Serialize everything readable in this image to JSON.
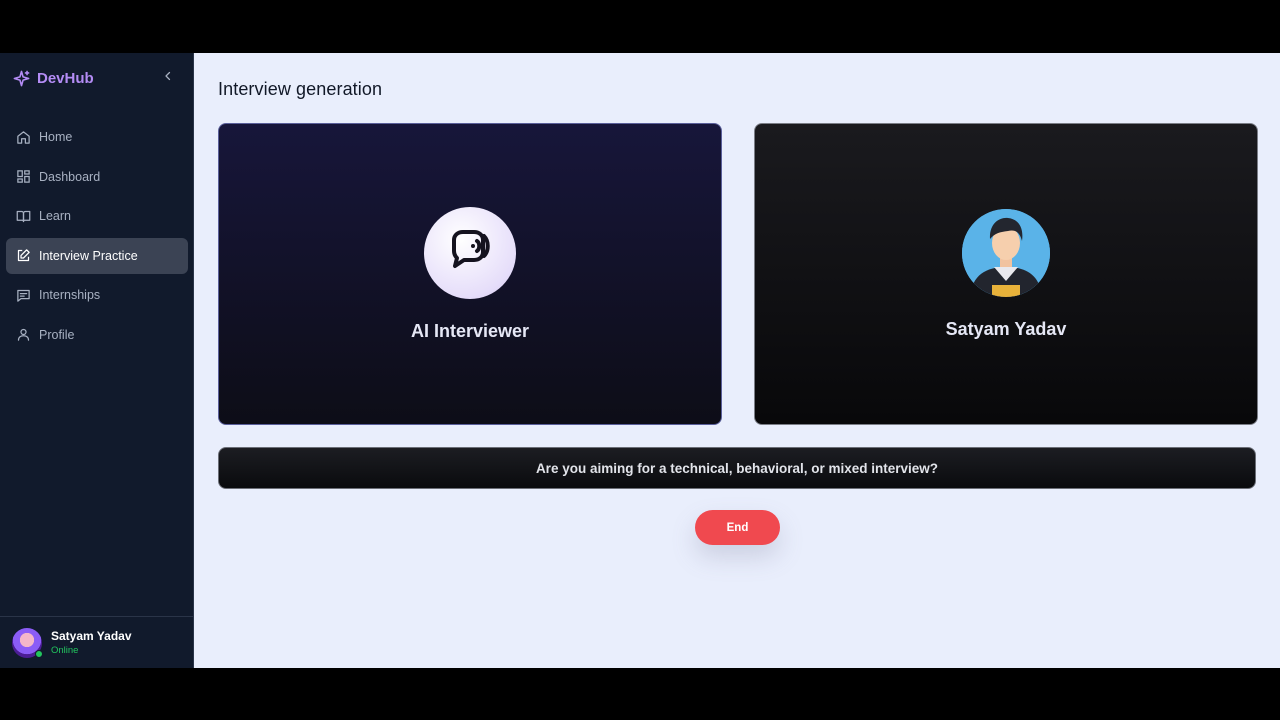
{
  "sidebar": {
    "brand": {
      "name": "DevHub",
      "icon": "sparkle-icon",
      "color": "#b48cf5"
    },
    "collapse_icon": "chevron-left-icon",
    "items": [
      {
        "label": "Home",
        "icon": "home-icon",
        "active": false
      },
      {
        "label": "Dashboard",
        "icon": "grid-icon",
        "active": false
      },
      {
        "label": "Learn",
        "icon": "book-icon",
        "active": false
      },
      {
        "label": "Interview Practice",
        "icon": "edit-icon",
        "active": true
      },
      {
        "label": "Internships",
        "icon": "message-icon",
        "active": false
      },
      {
        "label": "Profile",
        "icon": "user-icon",
        "active": false
      }
    ],
    "user": {
      "name": "Satyam Yadav",
      "status": "Online"
    }
  },
  "main": {
    "title": "Interview generation",
    "ai_card": {
      "label": "AI Interviewer",
      "icon": "chat-voice-icon"
    },
    "user_card": {
      "label": "Satyam Yadav"
    },
    "transcript": "Are you aiming for a technical, behavioral, or mixed interview?",
    "end_label": "End"
  },
  "colors": {
    "sidebar_bg": "#111a2c",
    "main_bg": "#e9eefc",
    "accent": "#b48cf5",
    "end_button": "#f0494f",
    "online": "#22c55e"
  }
}
